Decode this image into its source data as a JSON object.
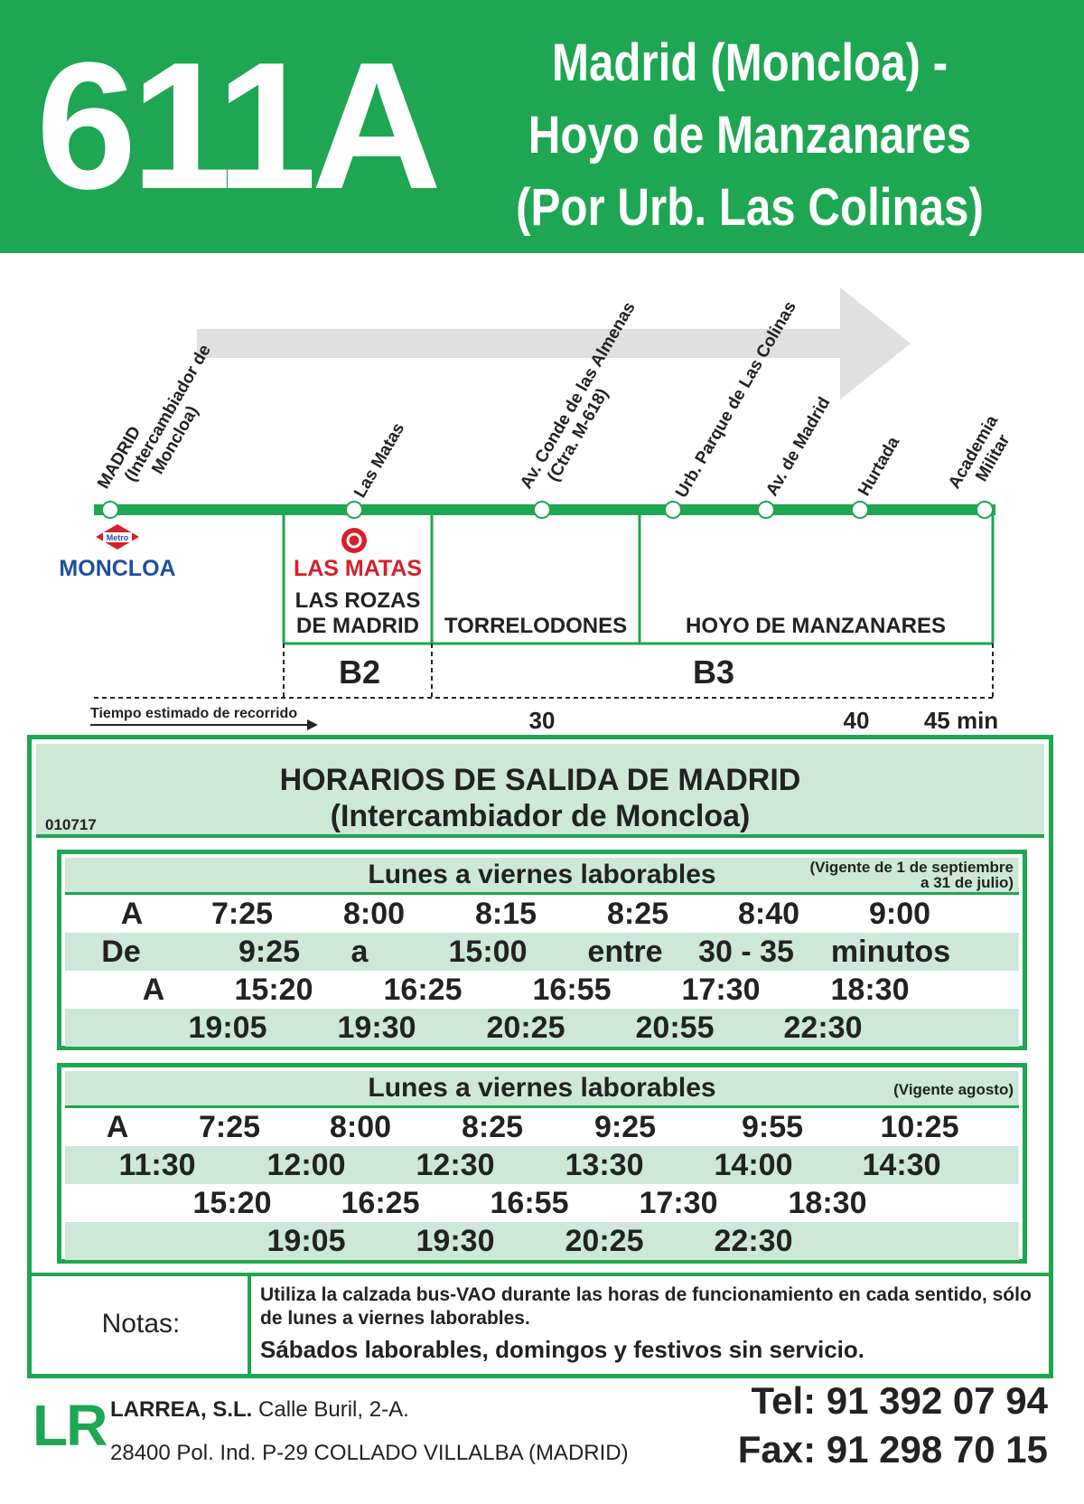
{
  "header": {
    "route_number": "611A",
    "title_line1": "Madrid (Moncloa) -",
    "title_line2": "Hoyo de Manzanares",
    "title_line3": "(Por Urb. Las Colinas)"
  },
  "route": {
    "stops": [
      "MADRID (Intercambiador de Moncloa)",
      "Las Matas",
      "Av. Conde de las Almenas (Ctra. M-618)",
      "Urb. Parque de Las Colinas",
      "Av. de Madrid",
      "Hurtada",
      "Academia Militar"
    ],
    "stop_label_lines": {
      "s0": [
        "MADRID",
        "(Intercambiador de",
        "Moncloa)"
      ],
      "s1": [
        "Las Matas"
      ],
      "s2": [
        "Av. Conde de las Almenas",
        "(Ctra. M-618)"
      ],
      "s3": [
        "Urb. Parque de Las Colinas"
      ],
      "s4": [
        "Av. de Madrid"
      ],
      "s5": [
        "Hurtada"
      ],
      "s6": [
        "Academia",
        "Militar"
      ]
    },
    "metro_label": "Metro",
    "moncloa": "MONCLOA",
    "cercanias": "LAS MATAS",
    "zones": [
      "LAS ROZAS",
      "DE MADRID",
      "TORRELODONES",
      "HOYO DE MANZANARES"
    ],
    "fare_zones": [
      "B2",
      "B3"
    ],
    "time_label": "Tiempo estimado de recorrido",
    "times": [
      "30",
      "40",
      "45 min"
    ],
    "colors": {
      "green": "#1ea653",
      "light_green": "#cde8d6",
      "arrow_gray": "#e0e0e0",
      "metro_red": "#d6202a",
      "metro_blue": "#1e4f9e"
    }
  },
  "schedule": {
    "title_line1": "HORARIOS DE SALIDA DE MADRID",
    "title_line2": "(Intercambiador de Moncloa)",
    "code": "010717",
    "tables": [
      {
        "day": "Lunes a viernes laborables",
        "valid_line1": "(Vigente de 1 de septiembre",
        "valid_line2": "a 31 de julio)",
        "rows": [
          [
            "A",
            "7:25",
            "8:00",
            "8:15",
            "8:25",
            "8:40",
            "9:00"
          ],
          [
            "De",
            "9:25",
            "a",
            "15:00",
            "entre",
            "30 - 35",
            "minutos"
          ],
          [
            "A",
            "15:20",
            "16:25",
            "16:55",
            "17:30",
            "18:30"
          ],
          [
            "19:05",
            "19:30",
            "20:25",
            "20:55",
            "22:30"
          ]
        ]
      },
      {
        "day": "Lunes a viernes laborables",
        "valid_line1": "(Vigente agosto)",
        "rows": [
          [
            "A",
            "7:25",
            "8:00",
            "8:25",
            "9:25",
            "9:55",
            "10:25"
          ],
          [
            "11:30",
            "12:00",
            "12:30",
            "13:30",
            "14:00",
            "14:30"
          ],
          [
            "15:20",
            "16:25",
            "16:55",
            "17:30",
            "18:30"
          ],
          [
            "19:05",
            "19:30",
            "20:25",
            "22:30"
          ]
        ]
      }
    ]
  },
  "notes": {
    "label": "Notas:",
    "note1": "Utiliza la calzada bus-VAO durante las horas de funcionamiento en cada sentido, sólo de lunes a viernes laborables.",
    "note2": "Sábados laborables, domingos y festivos sin servicio."
  },
  "footer": {
    "logo": "LR",
    "company": "LARREA, S.L.",
    "address1": "Calle Buril, 2-A.",
    "address2": "28400 Pol. Ind. P-29 COLLADO VILLALBA (MADRID)",
    "tel": "Tel: 91 392 07 94",
    "fax": "Fax: 91 298 70 15"
  }
}
